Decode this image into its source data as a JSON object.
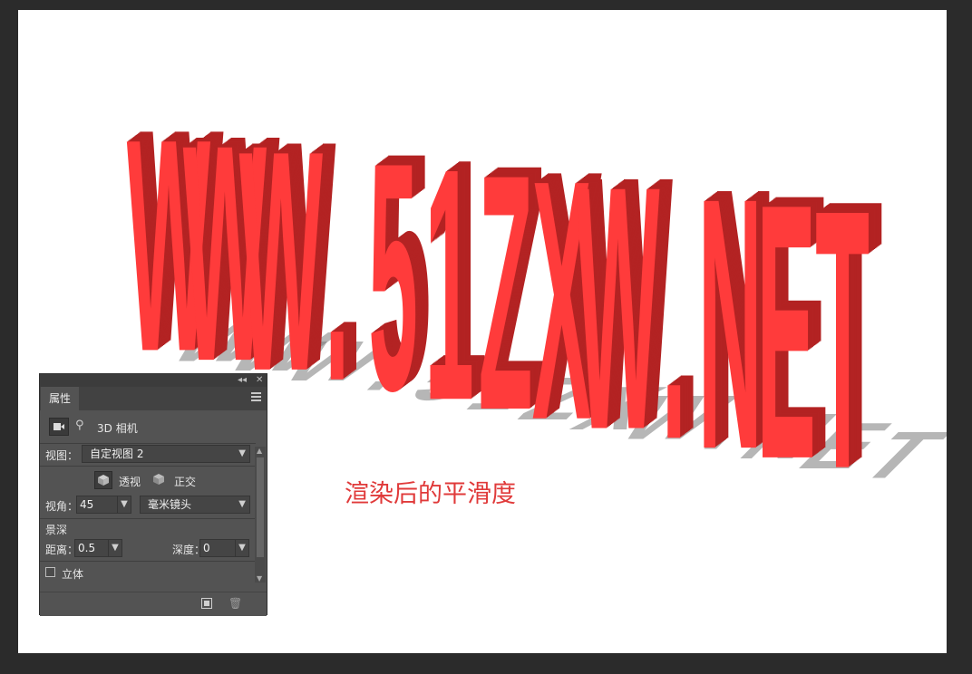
{
  "canvas": {
    "text3d": "WWW.51ZXW.NET",
    "caption": "渲染后的平滑度"
  },
  "colors": {
    "text_face": "#ff3b3b",
    "text_side": "#b32323",
    "shadow": "#7a7a7a",
    "panel_bg": "#535353"
  },
  "panel": {
    "collapse_icon": "double-chevron-left-icon",
    "close_icon": "close-icon",
    "tab_label": "属性",
    "menu_icon": "panel-menu-icon",
    "camera_icon": "camera-icon",
    "scene_icon": "3d-scene-icon",
    "section_title": "3D 相机",
    "view_label": "视图：",
    "view_value": "自定视图 2",
    "perspective_label": "透视",
    "orthographic_label": "正交",
    "fov_label": "视角：",
    "fov_value": "45",
    "unit_value": "毫米镜头",
    "dof_label": "景深",
    "distance_label": "距离：",
    "distance_value": "0.5",
    "depth_label": "深度：",
    "depth_value": "0",
    "stereo_label": "立体",
    "stereo_checked": false
  }
}
